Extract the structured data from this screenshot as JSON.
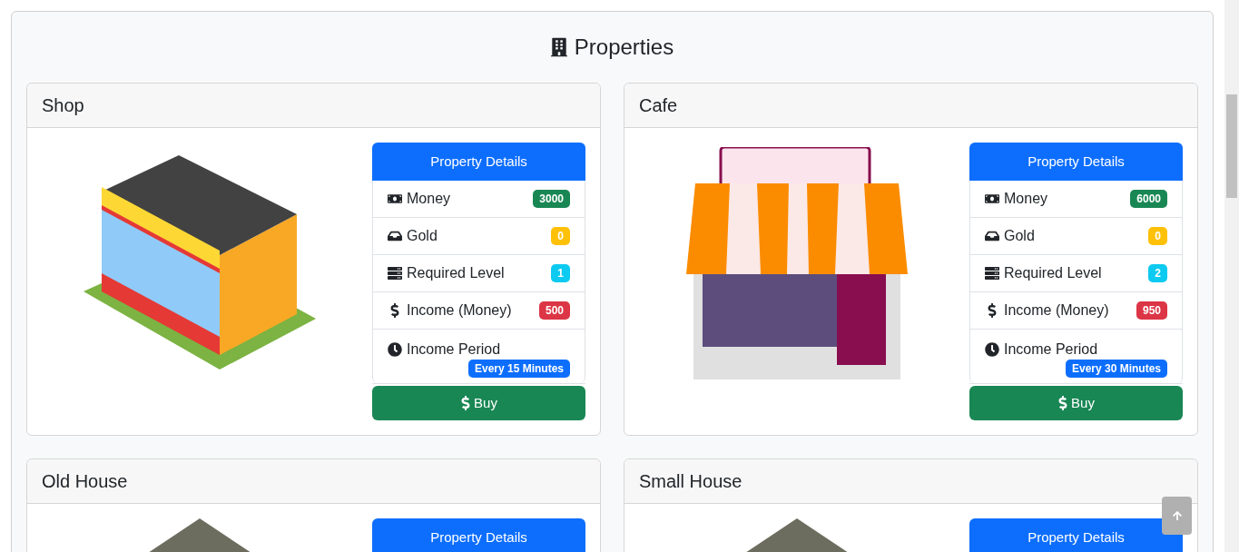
{
  "title": "Properties",
  "properties": [
    {
      "name": "Shop",
      "kind": "shop",
      "details_title": "Property Details",
      "details": [
        {
          "kind": "money",
          "label": "Money",
          "value": "3000"
        },
        {
          "kind": "gold",
          "label": "Gold",
          "value": "0"
        },
        {
          "kind": "level",
          "label": "Required Level",
          "value": "1"
        },
        {
          "kind": "income",
          "label": "Income (Money)",
          "value": "500"
        },
        {
          "kind": "period",
          "label": "Income Period",
          "value": "Every 15 Minutes"
        }
      ],
      "buy_label": "Buy"
    },
    {
      "name": "Cafe",
      "kind": "cafe",
      "details_title": "Property Details",
      "details": [
        {
          "kind": "money",
          "label": "Money",
          "value": "6000"
        },
        {
          "kind": "gold",
          "label": "Gold",
          "value": "0"
        },
        {
          "kind": "level",
          "label": "Required Level",
          "value": "2"
        },
        {
          "kind": "income",
          "label": "Income (Money)",
          "value": "950"
        },
        {
          "kind": "period",
          "label": "Income Period",
          "value": "Every 30 Minutes"
        }
      ],
      "buy_label": "Buy"
    },
    {
      "name": "Old House",
      "kind": "house",
      "details_title": "Property Details"
    },
    {
      "name": "Small House",
      "kind": "house",
      "details_title": "Property Details"
    }
  ]
}
